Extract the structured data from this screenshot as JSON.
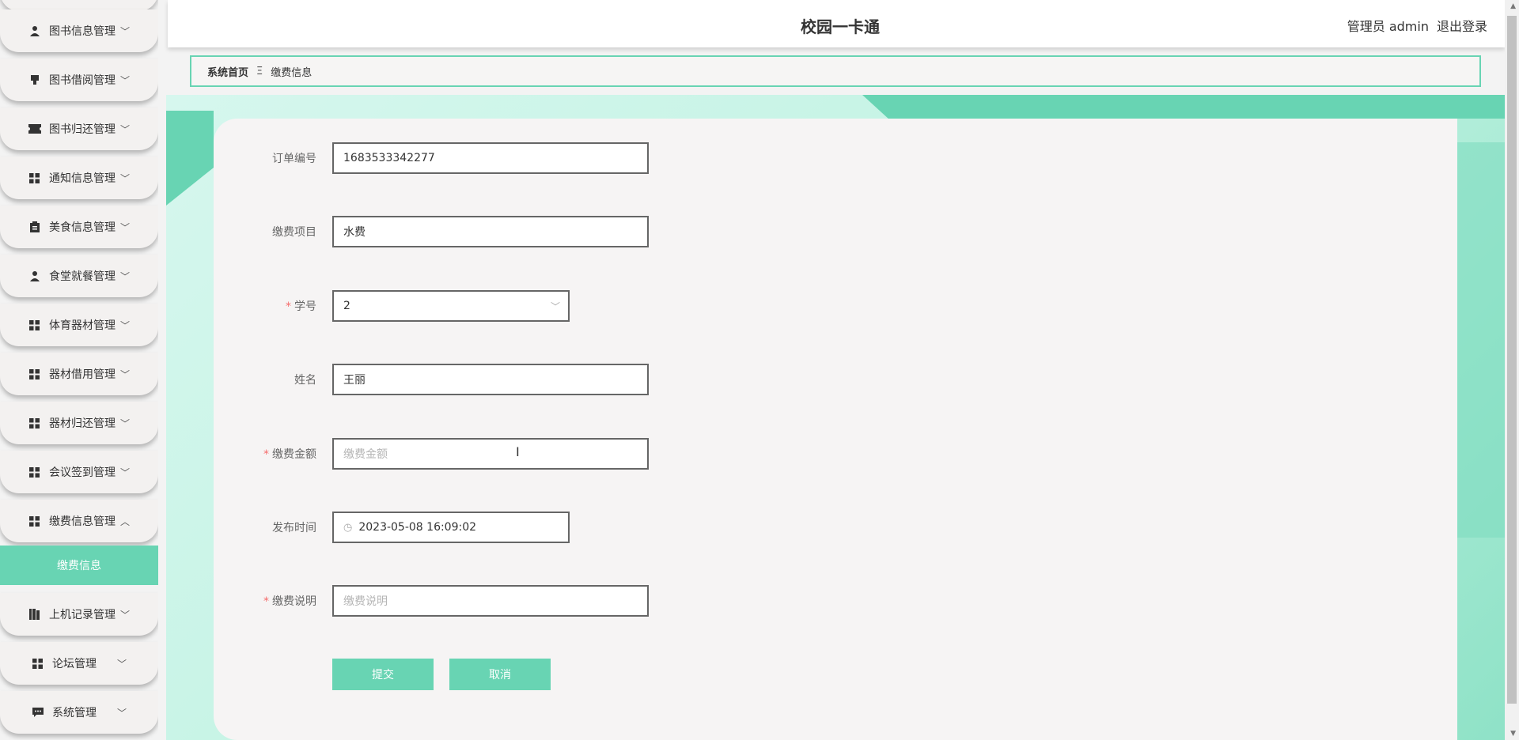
{
  "app_title": "校园一卡通",
  "header": {
    "user": "管理员 admin",
    "logout": "退出登录"
  },
  "breadcrumb": {
    "home": "系统首页",
    "separator": "Ξ",
    "current": "缴费信息"
  },
  "sidebar": {
    "items": [
      {
        "label": "图书信息管理",
        "icon": "user-icon"
      },
      {
        "label": "图书借阅管理",
        "icon": "stamp-icon"
      },
      {
        "label": "图书归还管理",
        "icon": "ticket-icon"
      },
      {
        "label": "通知信息管理",
        "icon": "grid-icon"
      },
      {
        "label": "美食信息管理",
        "icon": "clipboard-icon"
      },
      {
        "label": "食堂就餐管理",
        "icon": "user-icon"
      },
      {
        "label": "体育器材管理",
        "icon": "grid-icon"
      },
      {
        "label": "器材借用管理",
        "icon": "grid-icon"
      },
      {
        "label": "器材归还管理",
        "icon": "grid-icon"
      },
      {
        "label": "会议签到管理",
        "icon": "grid-icon"
      },
      {
        "label": "缴费信息管理",
        "icon": "grid-icon",
        "expanded": true
      },
      {
        "label": "上机记录管理",
        "icon": "book-icon"
      },
      {
        "label": "论坛管理",
        "icon": "grid-icon"
      },
      {
        "label": "系统管理",
        "icon": "chat-icon"
      }
    ],
    "active_subitem": "缴费信息"
  },
  "form": {
    "order_no": {
      "label": "订单编号",
      "value": "1683533342277"
    },
    "fee_item": {
      "label": "缴费项目",
      "value": "水费"
    },
    "student_id": {
      "label": "学号",
      "value": "2",
      "required": true
    },
    "name": {
      "label": "姓名",
      "value": "王丽"
    },
    "amount": {
      "label": "缴费金额",
      "placeholder": "缴费金额",
      "required": true
    },
    "publish_time": {
      "label": "发布时间",
      "value": "2023-05-08 16:09:02"
    },
    "note": {
      "label": "缴费说明",
      "placeholder": "缴费说明",
      "required": true
    },
    "submit": "提交",
    "cancel": "取消"
  },
  "colors": {
    "accent": "#68d4b3",
    "required": "#f56c6c"
  }
}
